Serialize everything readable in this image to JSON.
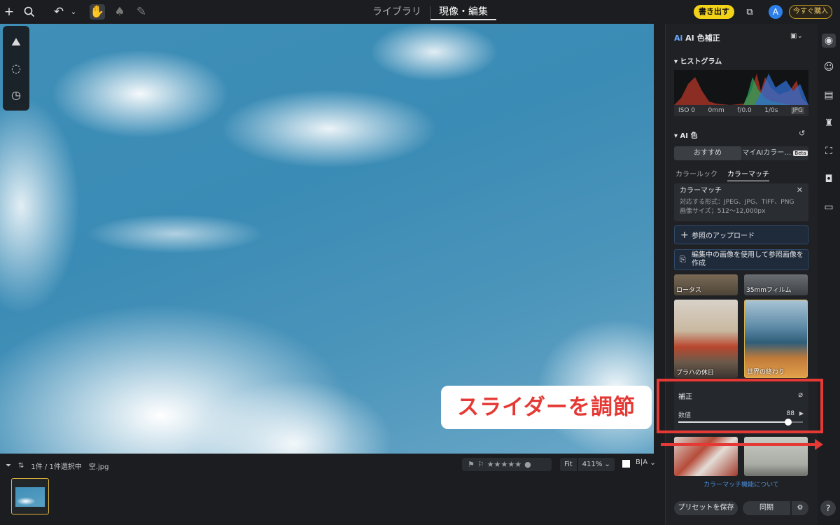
{
  "topbar": {
    "tab_library": "ライブラリ",
    "tab_develop": "現像・編集",
    "export_label": "書き出す",
    "avatar_letter": "A",
    "buy_label": "今すぐ購入"
  },
  "annotation": {
    "callout_text": "スライダーを調節",
    "accent_color": "#e53935"
  },
  "filmstrip": {
    "selection_text": "1件 / 1件選択中",
    "filename": "空.jpg",
    "fit_label": "Fit",
    "zoom_label": "411%"
  },
  "panel": {
    "title": "AI 色補正",
    "histogram_label": "ヒストグラム",
    "exif": {
      "iso": "ISO 0",
      "focal": "0mm",
      "aperture": "f/0.0",
      "shutter": "1/0s",
      "format": "JPG"
    },
    "ai_color_label": "AI 色",
    "seg_recommended": "おすすめ",
    "seg_my_ai": "マイAIカラー…",
    "beta_badge": "Beta",
    "subtab_color_look": "カラールック",
    "subtab_color_match": "カラーマッチ",
    "info": {
      "title": "カラーマッチ",
      "formats": "対応する形式：JPEG、JPG、TIFF、PNG",
      "size": "画像サイズ；512〜12,000px"
    },
    "upload_reference": "参照のアップロード",
    "create_reference": "編集中の画像を使用して参照画像を作成",
    "presets": [
      "ロータス",
      "35mmフィルム",
      "プラハの休日",
      "世界の終わり"
    ],
    "correction": {
      "title": "補正",
      "value_label": "数値",
      "value": "88",
      "fraction": 0.88
    },
    "about_link": "カラーマッチ機能について",
    "save_preset": "プリセットを保存",
    "sync": "同期"
  },
  "help_label": "?"
}
